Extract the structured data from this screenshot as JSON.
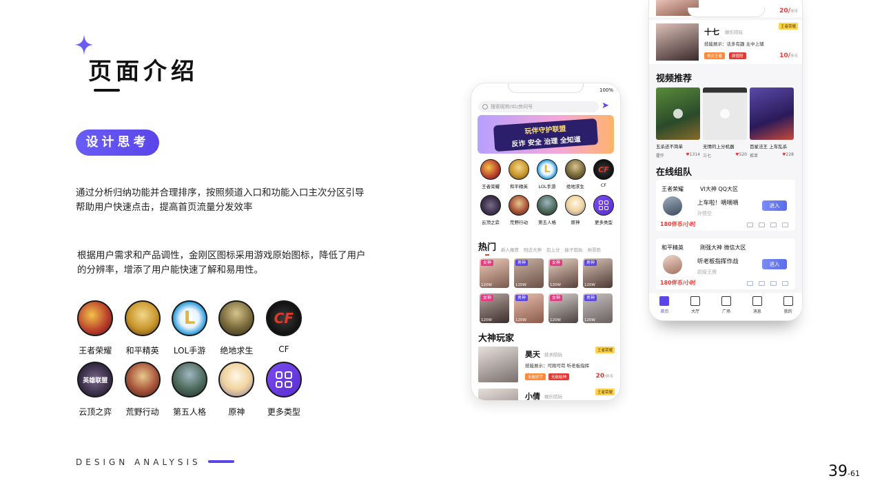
{
  "header": {
    "title": "页面介绍",
    "tag": "设计思考"
  },
  "paragraphs": [
    "通过分析归纳功能并合理排序，按照频道入口和功能入口主次分区引导帮助用户快速点击，提高首页流量分发效率",
    "根据用户需求和产品调性，金刚区图标采用游戏原始图标，降低了用户的分辨率，增添了用户能快速了解和易用性。"
  ],
  "games": [
    {
      "name": "王者荣耀",
      "icon": "wzry-icon"
    },
    {
      "name": "和平精英",
      "icon": "hpjy-icon"
    },
    {
      "name": "LOL手游",
      "icon": "lol-icon"
    },
    {
      "name": "绝地求生",
      "icon": "jdqs-icon"
    },
    {
      "name": "CF",
      "icon": "cf-icon"
    },
    {
      "name": "云顶之弈",
      "icon": "ydzy-icon"
    },
    {
      "name": "荒野行动",
      "icon": "hyxd-icon"
    },
    {
      "name": "第五人格",
      "icon": "dwrg-icon"
    },
    {
      "name": "原神",
      "icon": "ys-icon"
    },
    {
      "name": "更多类型",
      "icon": "more-grid-icon"
    }
  ],
  "icon_glyphs": {
    "lol": "L",
    "cf": "CF",
    "ydzy": "英雄联盟"
  },
  "footer": {
    "label": "DESIGN ANALYSIS",
    "page": "39",
    "total": "-61"
  },
  "phone1": {
    "status_time": "",
    "battery": "100%",
    "search_placeholder": "搜索昵称/ID/房间号",
    "banner_line1": "玩伴守护联盟",
    "banner_line2": "反诈 安全 治理 全知道",
    "hot_label": "热门",
    "hot_tabs": [
      "新人推荐",
      "附近大神",
      "包上分",
      "妹子陪玩",
      "帅哥陪"
    ],
    "hot_cards": [
      {
        "tag": "女神",
        "views": "120W"
      },
      {
        "tag": "男神",
        "views": "120W"
      },
      {
        "tag": "女神",
        "views": "120W"
      },
      {
        "tag": "男神",
        "views": "120W"
      },
      {
        "tag": "女神",
        "views": "120W"
      },
      {
        "tag": "男神",
        "views": "120W"
      },
      {
        "tag": "女神",
        "views": "120W"
      },
      {
        "tag": "男神",
        "views": "120W"
      }
    ],
    "players_title": "大神玩家",
    "players": [
      {
        "name": "昊天",
        "sub": "技术陪玩",
        "skill": "技能展示：可刚可苟  听老板指挥",
        "tags": [
          "无敌好手",
          "无敌给神"
        ],
        "price": "20",
        "unit": "/伴币",
        "badge": "王者荣耀"
      },
      {
        "name": "小倩",
        "sub": "娱乐陪玩",
        "skill": "",
        "tags": [],
        "price": "",
        "unit": "",
        "badge": "王者荣耀"
      }
    ]
  },
  "phone2": {
    "top_price": "20/",
    "top_unit": "伴币",
    "shiqi": {
      "name": "十七",
      "sub": "娱乐陪玩",
      "skill": "技能展示：话多有趣    主中上辅",
      "tags": [
        "美女王者",
        "颜值陪"
      ],
      "price": "10/",
      "unit": "伴币",
      "badge": "王者荣耀"
    },
    "videos_title": "视频推荐",
    "videos": [
      {
        "caption": "五杀还不简单",
        "user": "霍仟",
        "likes": "1314"
      },
      {
        "caption": "无情的上分机器",
        "user": "三七",
        "likes": "520"
      },
      {
        "caption": "百星法王 上车乱杀",
        "user": "孤单",
        "likes": "228"
      }
    ],
    "team_title": "在线组队",
    "teams": [
      {
        "game": "王者荣耀",
        "room": "VI大神 QQ大区",
        "msg": "上车啦！嘀嘀嘀",
        "user": "孙悟空",
        "price": "180伴币/小时",
        "join": "进入"
      },
      {
        "game": "和平精英",
        "room": "刚强大神 微信大区",
        "msg": "听老板指挥作战",
        "user": "超级王牌",
        "price": "180伴币/小时",
        "join": "进入"
      }
    ],
    "tabs": [
      "首页",
      "大厅",
      "广场",
      "消息",
      "我的"
    ]
  },
  "colors": {
    "accent": "#5a46e8",
    "price": "#e53935"
  }
}
